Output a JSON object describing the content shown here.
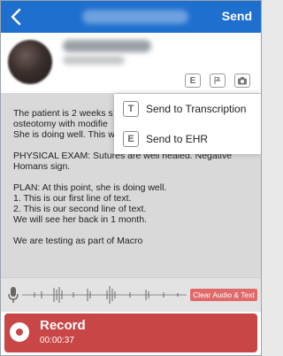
{
  "header": {
    "send_label": "Send"
  },
  "menu": {
    "items": [
      {
        "glyph": "T",
        "label": "Send to Transcription"
      },
      {
        "glyph": "E",
        "label": "Send to EHR"
      }
    ]
  },
  "toolbar": {
    "ehr_glyph": "E",
    "icons": [
      "ehr-icon",
      "text-icon",
      "camera-icon"
    ]
  },
  "note": {
    "line1": "The patient is 2 weeks s",
    "line2": "osteotomy with modifie",
    "line3": "She is doing well. This w",
    "exam": "PHYSICAL EXAM: Sutures are well healed. Negative Homans sign.",
    "plan": "PLAN: At this point, she is doing well.",
    "plan1": "1. This is our first line of text.",
    "plan2": "2. This is our second line of text.",
    "followup": "We will see her back in 1 month.",
    "macro": "We are testing as part of Macro"
  },
  "audio": {
    "clear_label": "Clear Audio & Text"
  },
  "record": {
    "label": "Record",
    "time": "00:00:37"
  },
  "colors": {
    "header": "#1f6fcf",
    "record": "#c84646",
    "clear": "#e06a6a"
  }
}
